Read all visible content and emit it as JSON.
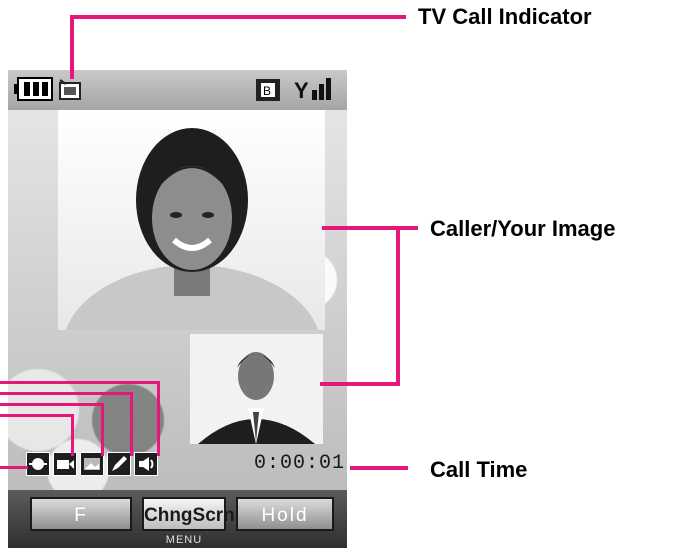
{
  "labels": {
    "tv_call_indicator": "TV Call Indicator",
    "caller_your_image": "Caller/Your Image",
    "call_time": "Call Time"
  },
  "status_bar": {
    "icons": [
      "battery-icon",
      "tv-call-indicator-icon",
      "memory-card-icon",
      "signal-strength-icon"
    ]
  },
  "call": {
    "time": "0:00:01",
    "status_icons": [
      "light-icon",
      "video-camera-icon",
      "image-icon",
      "pen-icon",
      "speaker-icon"
    ]
  },
  "softkeys": {
    "left_label": "F",
    "center_label": "ChngScrn",
    "right_label": "Hold",
    "menu_label": "MENU"
  },
  "colors": {
    "callout_line": "#e6167a",
    "screen_bg": "#9e9e9e"
  }
}
